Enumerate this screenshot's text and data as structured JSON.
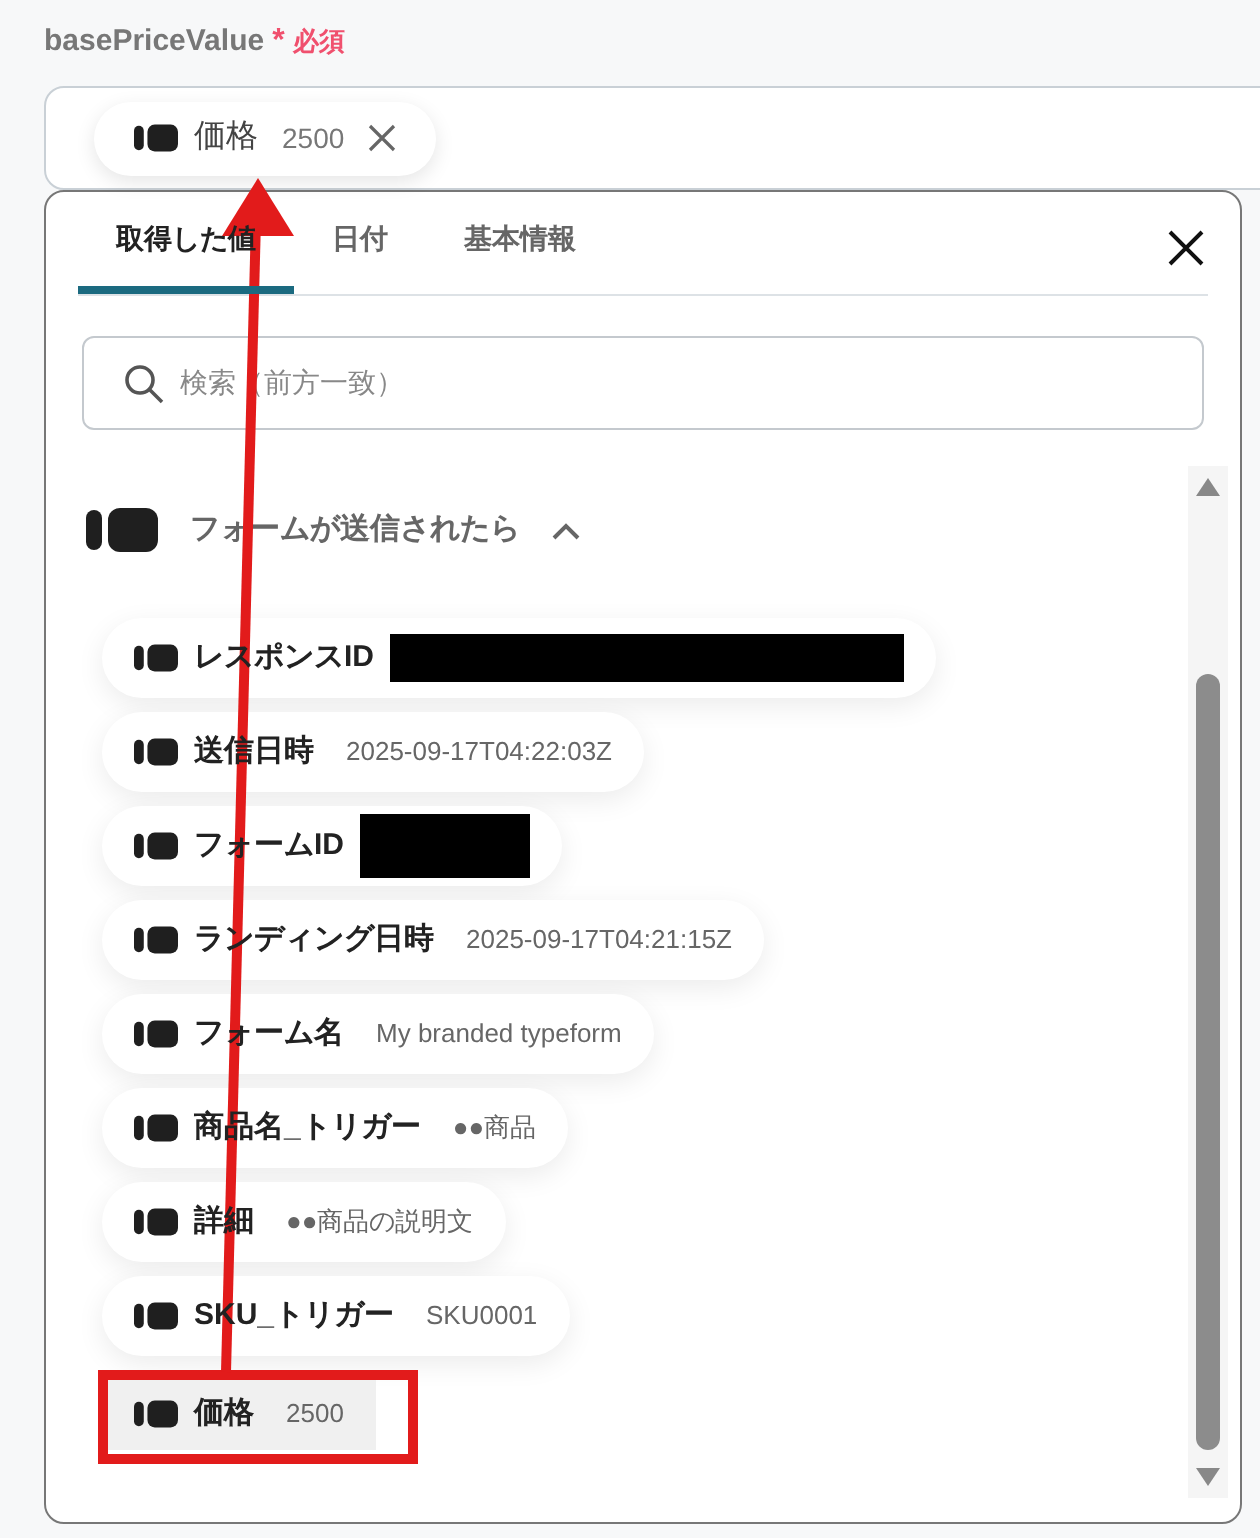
{
  "field": {
    "label": "basePriceValue",
    "required_mark": "*",
    "required_text": "必須",
    "chip": {
      "name": "価格",
      "value": "2500"
    }
  },
  "popup": {
    "tabs": [
      {
        "label": "取得した値",
        "selected": true
      },
      {
        "label": "日付",
        "selected": false
      },
      {
        "label": "基本情報",
        "selected": false
      }
    ],
    "search": {
      "placeholder": "検索（前方一致）"
    },
    "group": {
      "title": "フォームが送信されたら",
      "expanded": true
    },
    "items": [
      {
        "kind": "redacted",
        "name": "レスポンスID",
        "selected": false
      },
      {
        "kind": "value",
        "name": "送信日時",
        "value": "2025-09-17T04:22:03Z",
        "selected": false
      },
      {
        "kind": "redacted",
        "name": "フォームID",
        "selected": false
      },
      {
        "kind": "value",
        "name": "ランディング日時",
        "value": "2025-09-17T04:21:15Z",
        "selected": false
      },
      {
        "kind": "value",
        "name": "フォーム名",
        "value": "My branded typeform",
        "selected": false
      },
      {
        "kind": "value",
        "name": "商品名_トリガー",
        "value": "●●商品",
        "selected": false
      },
      {
        "kind": "value",
        "name": "詳細",
        "value": "●●商品の説明文",
        "selected": false
      },
      {
        "kind": "value",
        "name": "SKU_トリガー",
        "value": "SKU0001",
        "selected": false
      },
      {
        "kind": "value",
        "name": "価格",
        "value": "2500",
        "selected": true
      }
    ]
  }
}
